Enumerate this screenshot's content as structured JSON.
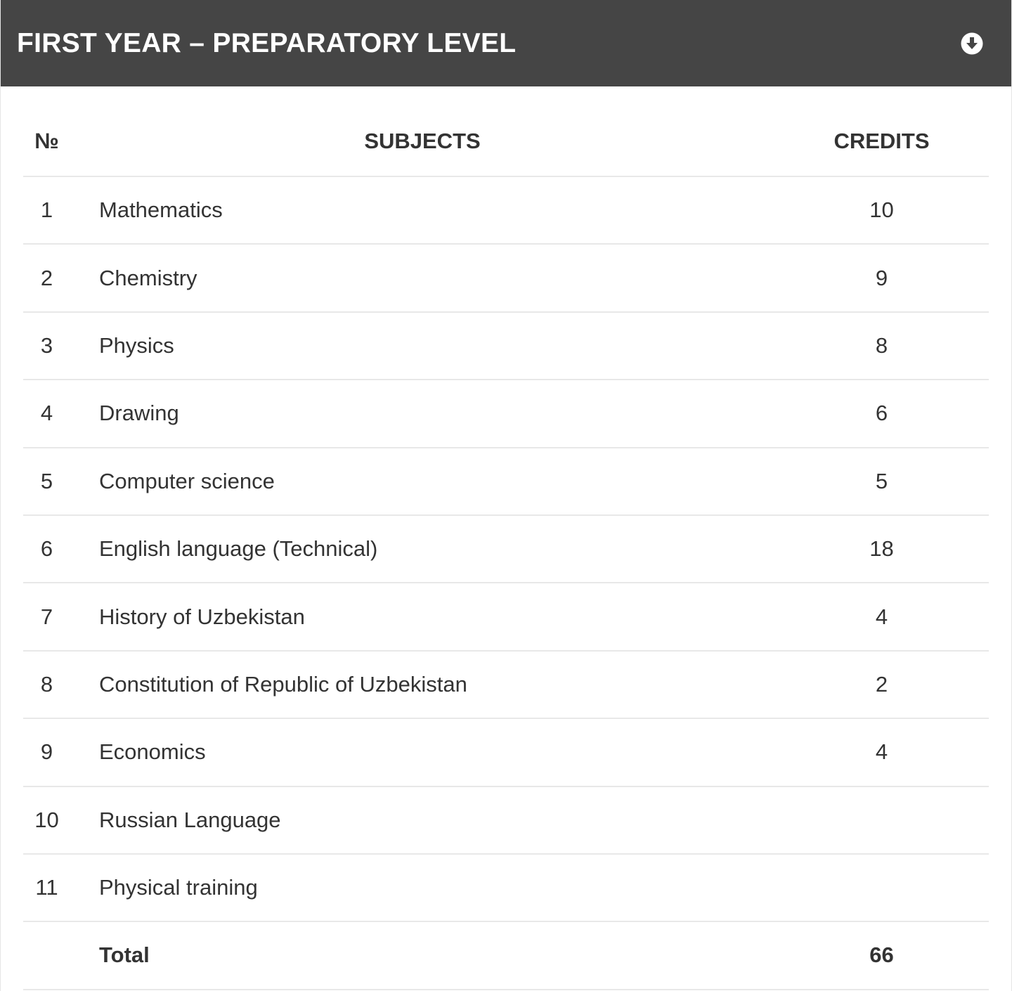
{
  "header": {
    "title": "FIRST YEAR – PREPARATORY LEVEL",
    "download_icon": "download-circle-icon",
    "background_color": "#454545"
  },
  "table": {
    "columns": {
      "number": "№",
      "subjects": "SUBJECTS",
      "credits": "CREDITS"
    },
    "rows": [
      {
        "num": "1",
        "subject": "Mathematics",
        "credits": "10"
      },
      {
        "num": "2",
        "subject": "Chemistry",
        "credits": "9"
      },
      {
        "num": "3",
        "subject": "Physics",
        "credits": "8"
      },
      {
        "num": "4",
        "subject": "Drawing",
        "credits": "6"
      },
      {
        "num": "5",
        "subject": "Computer science",
        "credits": "5"
      },
      {
        "num": "6",
        "subject": "English language (Technical)",
        "credits": "18"
      },
      {
        "num": "7",
        "subject": "History of Uzbekistan",
        "credits": "4"
      },
      {
        "num": "8",
        "subject": "Constitution of Republic of Uzbekistan",
        "credits": "2"
      },
      {
        "num": "9",
        "subject": "Economics",
        "credits": "4"
      },
      {
        "num": "10",
        "subject": "Russian Language",
        "credits": ""
      },
      {
        "num": "11",
        "subject": "Physical training",
        "credits": ""
      }
    ],
    "total": {
      "label": "Total",
      "credits": "66"
    }
  }
}
